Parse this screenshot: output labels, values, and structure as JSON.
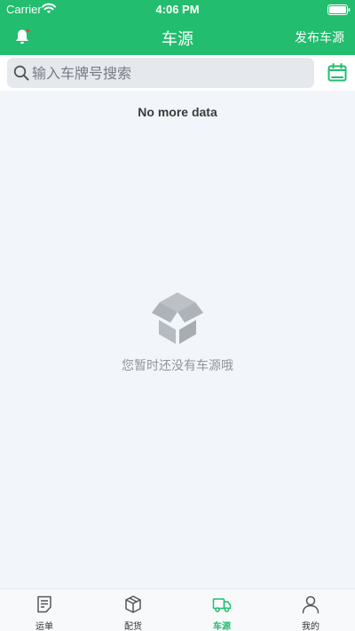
{
  "status_bar": {
    "carrier": "Carrier",
    "time": "4:06 PM"
  },
  "nav": {
    "title": "车源",
    "action": "发布车源"
  },
  "search": {
    "placeholder": "输入车牌号搜索"
  },
  "list": {
    "end_text": "No more data"
  },
  "empty": {
    "message": "您暂时还没有车源哦"
  },
  "tabs": [
    {
      "label": "运单",
      "icon": "document-icon",
      "active": false
    },
    {
      "label": "配货",
      "icon": "package-icon",
      "active": false
    },
    {
      "label": "车源",
      "icon": "truck-icon",
      "active": true
    },
    {
      "label": "我的",
      "icon": "person-icon",
      "active": false
    }
  ],
  "colors": {
    "brand": "#22bd6e",
    "background": "#f2f6fa",
    "empty_text": "#8f959d",
    "tab_inactive": "#555555"
  }
}
